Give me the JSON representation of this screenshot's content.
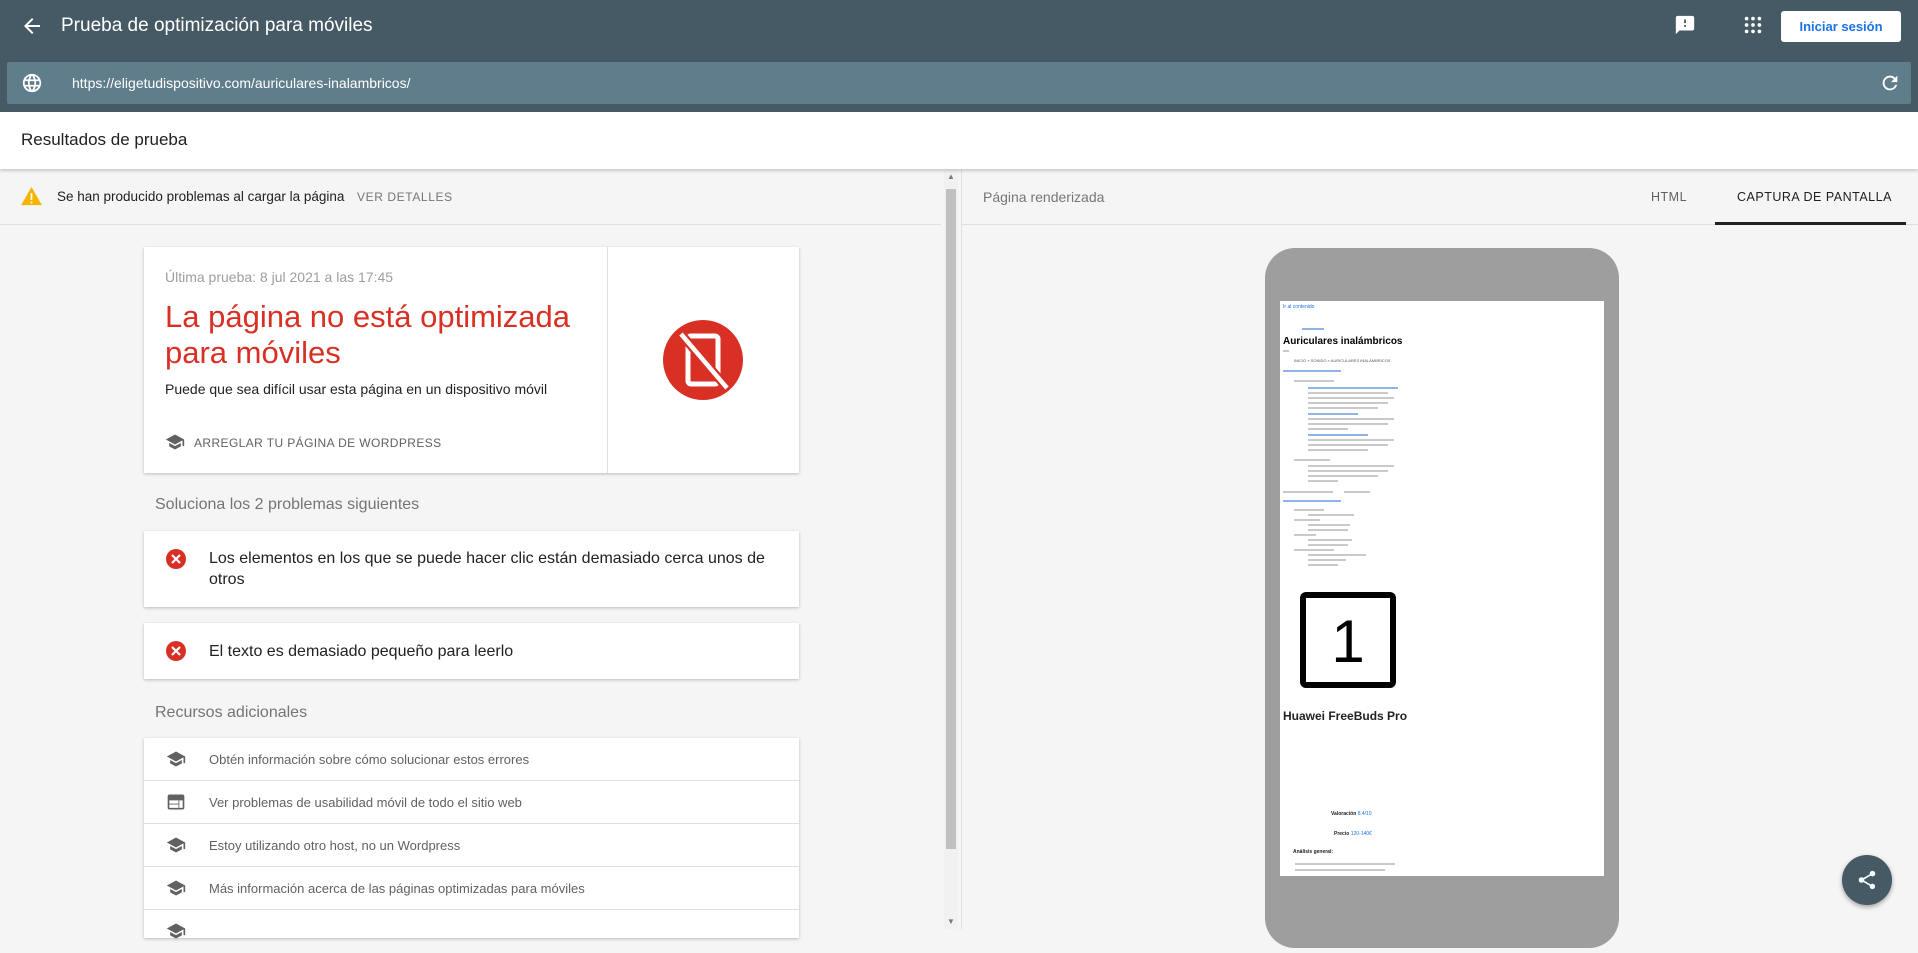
{
  "header": {
    "title": "Prueba de optimización para móviles",
    "signin_label": "Iniciar sesión",
    "url": "https://eligetudispositivo.com/auriculares-inalambricos/"
  },
  "results": {
    "title": "Resultados de prueba"
  },
  "warning": {
    "text": "Se han producido problemas al cargar la página",
    "link": "VER DETALLES"
  },
  "summary": {
    "last_test": "Última prueba: 8 jul 2021 a las 17:45",
    "headline": "La página no está optimizada para móviles",
    "subline": "Puede que sea difícil usar esta página en un dispositivo móvil",
    "fix_label": "ARREGLAR TU PÁGINA DE WORDPRESS"
  },
  "issues": {
    "heading": "Soluciona los 2 problemas siguientes",
    "items": [
      "Los elementos en los que se puede hacer clic están demasiado cerca unos de otros",
      "El texto es demasiado pequeño para leerlo"
    ]
  },
  "resources": {
    "heading": "Recursos adicionales",
    "items": [
      "Obtén información sobre cómo solucionar estos errores",
      "Ver problemas de usabilidad móvil de todo el sitio web",
      "Estoy utilizando otro host, no un Wordpress",
      "Más información acerca de las páginas optimizadas para móviles"
    ]
  },
  "preview": {
    "label": "Página renderizada",
    "tabs": [
      "HTML",
      "CAPTURA DE PANTALLA"
    ],
    "active_tab": "CAPTURA DE PANTALLA",
    "screenshot": {
      "skip_link": "Ir al contenido",
      "page_title": "Auriculares inalámbricos",
      "breadcrumb": "INICIO » SONIDO » AURICULARES INALÁMBRICOS",
      "rank_number": "1",
      "product_name": "Huawei FreeBuds Pro",
      "rating_label": "Valoración",
      "rating_value": "8.4/10",
      "price_label": "Precio",
      "price_value": "120-140€",
      "analysis_label": "Análisis general:"
    }
  },
  "colors": {
    "header": "#455a64",
    "urlbar": "#607d8b",
    "error": "#d93025",
    "warning": "#f4b400"
  }
}
